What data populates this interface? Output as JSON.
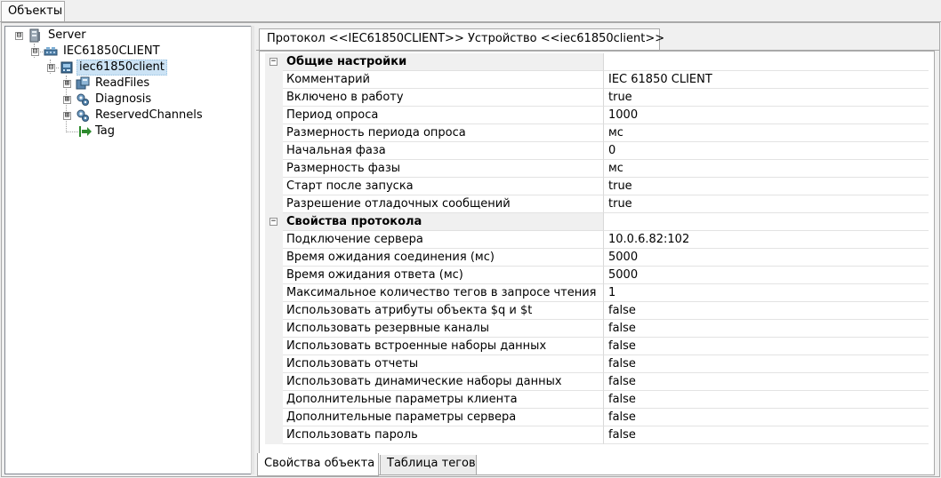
{
  "window": {
    "tab_label": "Объекты"
  },
  "tree": {
    "items": [
      {
        "label": "Server",
        "icon": "server-icon",
        "expander": "⊟"
      },
      {
        "label": "IEC61850CLIENT",
        "icon": "network-protocol-icon",
        "expander": "⊟"
      },
      {
        "label": "iec61850client",
        "icon": "device-icon",
        "expander": "⊟",
        "selected": true
      },
      {
        "label": "ReadFiles",
        "icon": "folder-device-icon",
        "expander": "⊞"
      },
      {
        "label": "Diagnosis",
        "icon": "gear-group-icon",
        "expander": "⊞"
      },
      {
        "label": "ReservedChannels",
        "icon": "gear-group-icon",
        "expander": "⊞"
      },
      {
        "label": "Tag",
        "icon": "tag-arrow-icon"
      }
    ]
  },
  "properties": {
    "tab_label": "Протокол <<IEC61850CLIENT>> Устройство <<iec61850client>>",
    "categories": [
      {
        "name": "Общие настройки",
        "rows": [
          {
            "name": "Комментарий",
            "value": "IEC 61850 CLIENT"
          },
          {
            "name": "Включено в работу",
            "value": "true"
          },
          {
            "name": "Период опроса",
            "value": "1000"
          },
          {
            "name": "Размерность периода опроса",
            "value": "мс"
          },
          {
            "name": "Начальная фаза",
            "value": "0"
          },
          {
            "name": "Размерность фазы",
            "value": "мс"
          },
          {
            "name": "Старт после запуска",
            "value": "true"
          },
          {
            "name": "Разрешение отладочных сообщений",
            "value": "true"
          }
        ]
      },
      {
        "name": "Свойства протокола",
        "rows": [
          {
            "name": "Подключение сервера",
            "value": "10.0.6.82:102"
          },
          {
            "name": "Время ожидания соединения (мс)",
            "value": "5000"
          },
          {
            "name": "Время ожидания ответа (мс)",
            "value": "5000"
          },
          {
            "name": "Максимальное количество тегов в запросе чтения",
            "value": "1"
          },
          {
            "name": "Использовать атрибуты объекта $q и $t",
            "value": "false"
          },
          {
            "name": "Использовать резервные каналы",
            "value": "false"
          },
          {
            "name": "Использовать встроенные наборы данных",
            "value": "false"
          },
          {
            "name": "Использовать отчеты",
            "value": "false"
          },
          {
            "name": "Использовать динамические наборы данных",
            "value": "false"
          },
          {
            "name": "Дополнительные параметры клиента",
            "value": "false"
          },
          {
            "name": "Дополнительные параметры сервера",
            "value": "false"
          },
          {
            "name": "Использовать пароль",
            "value": "false"
          }
        ]
      }
    ]
  },
  "bottom_tabs": {
    "object_properties": "Свойства объекта",
    "tag_table": "Таблица тегов"
  },
  "colors": {
    "selection": "#cce3f5",
    "category_bg": "#f0f0f0",
    "tag_arrow": "#2e8b2e"
  }
}
